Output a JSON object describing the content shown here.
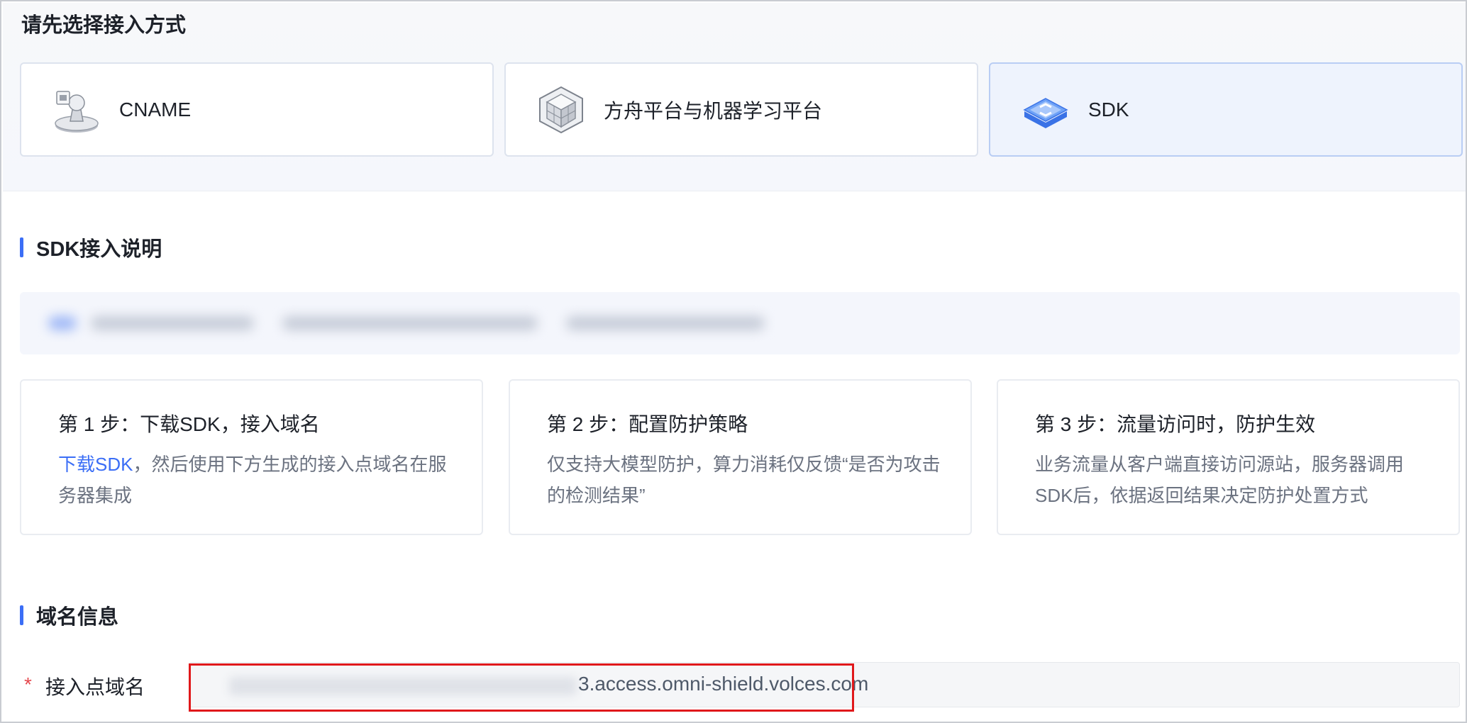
{
  "top": {
    "title": "请先选择接入方式",
    "methods": [
      {
        "label": "CNAME",
        "icon": "cname-pawn-icon",
        "selected": false
      },
      {
        "label": "方舟平台与机器学习平台",
        "icon": "cube-platform-icon",
        "selected": false
      },
      {
        "label": "SDK",
        "icon": "sdk-chip-icon",
        "selected": true
      }
    ]
  },
  "sdk_section": {
    "title": "SDK接入说明",
    "steps": [
      {
        "title": "第 1 步：下载SDK，接入域名",
        "link": "下载SDK",
        "desc": "，然后使用下方生成的接入点域名在服务器集成"
      },
      {
        "title": "第 2 步：配置防护策略",
        "desc": "仅支持大模型防护，算力消耗仅反馈“是否为攻击的检测结果”"
      },
      {
        "title": "第 3 步：流量访问时，防护生效",
        "desc": "业务流量从客户端直接访问源站，服务器调用SDK后，依据返回结果决定防护处置方式"
      }
    ]
  },
  "domain_section": {
    "title": "域名信息",
    "field": {
      "required_mark": "*",
      "label": "接入点域名",
      "value_visible": "3.access.omni-shield.volces.com"
    }
  },
  "colors": {
    "accent": "#3b6ef6",
    "required": "#e5484d",
    "highlight": "#e0181b"
  }
}
